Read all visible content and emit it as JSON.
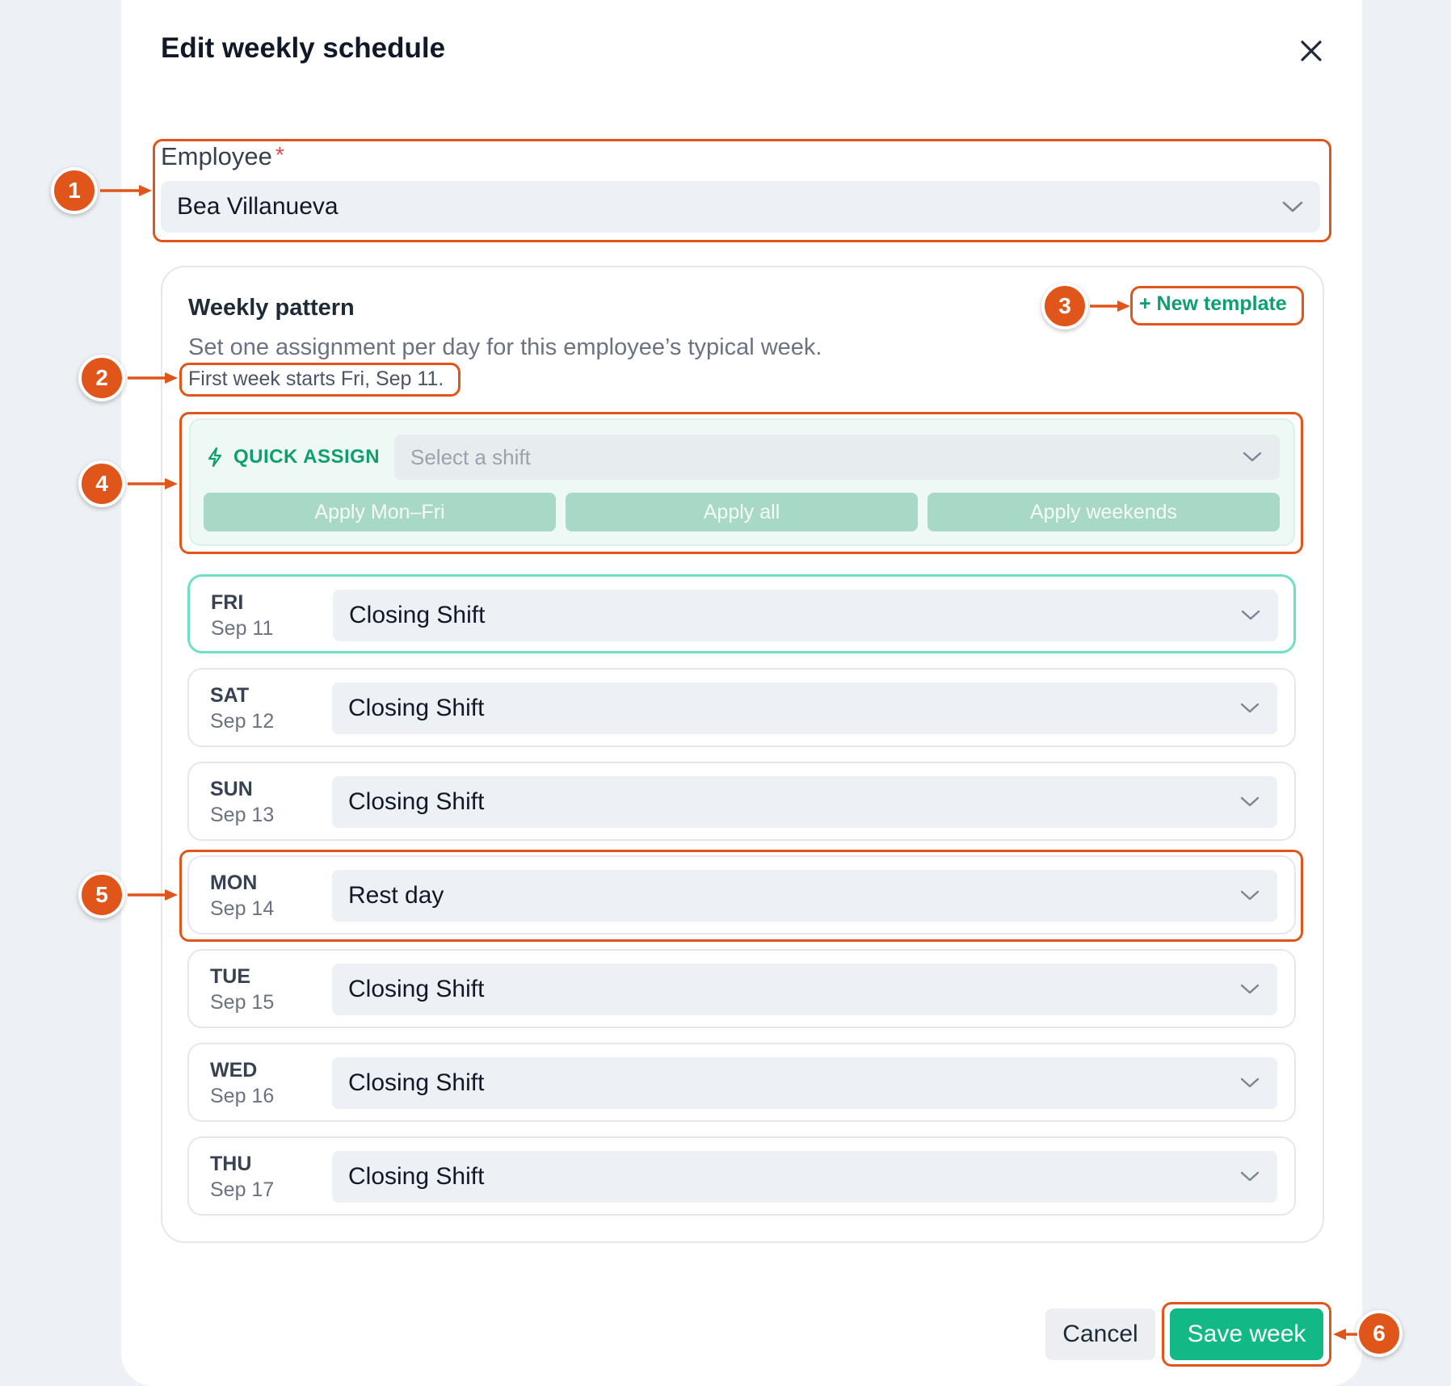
{
  "modal": {
    "title": "Edit weekly schedule",
    "close_icon": "close-icon"
  },
  "employee": {
    "label": "Employee",
    "required_mark": "*",
    "value": "Bea Villanueva"
  },
  "pattern": {
    "title": "Weekly pattern",
    "new_template_label": "+ New template",
    "description": "Set one assignment per day for this employee’s typical week.",
    "first_week_note": "First week starts Fri, Sep 11."
  },
  "quick_assign": {
    "label": "QUICK ASSIGN",
    "icon": "lightning-icon",
    "placeholder": "Select a shift",
    "buttons": [
      "Apply Mon–Fri",
      "Apply all",
      "Apply weekends"
    ]
  },
  "days": [
    {
      "name": "FRI",
      "date": "Sep 11",
      "value": "Closing Shift"
    },
    {
      "name": "SAT",
      "date": "Sep 12",
      "value": "Closing Shift"
    },
    {
      "name": "SUN",
      "date": "Sep 13",
      "value": "Closing Shift"
    },
    {
      "name": "MON",
      "date": "Sep 14",
      "value": "Rest day"
    },
    {
      "name": "TUE",
      "date": "Sep 15",
      "value": "Closing Shift"
    },
    {
      "name": "WED",
      "date": "Sep 16",
      "value": "Closing Shift"
    },
    {
      "name": "THU",
      "date": "Sep 17",
      "value": "Closing Shift"
    }
  ],
  "footer": {
    "cancel_label": "Cancel",
    "save_label": "Save week"
  },
  "annotations": [
    "1",
    "2",
    "3",
    "4",
    "5",
    "6"
  ],
  "colors": {
    "accent": "#12b886",
    "annotation": "#e0561a",
    "required": "#e5484d"
  }
}
